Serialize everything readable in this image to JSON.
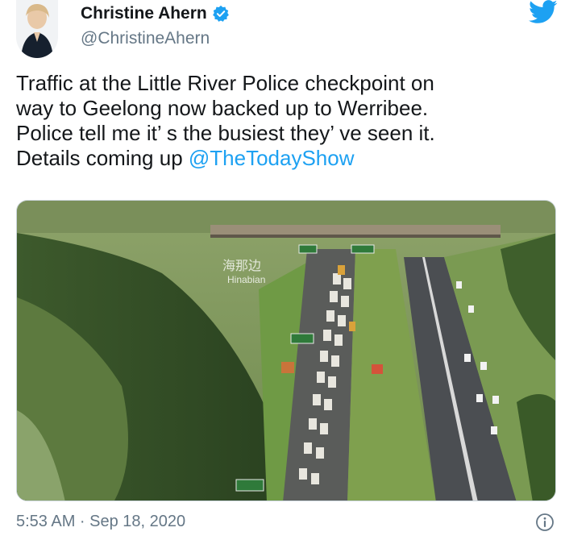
{
  "author": {
    "display_name": "Christine Ahern",
    "handle": "@ChristineAhern"
  },
  "icons": {
    "verified": "verified-badge-icon",
    "platform": "twitter-bird-icon",
    "info": "info-icon"
  },
  "tweet": {
    "line1": "Traffic at the Little River Police checkpoint on",
    "line2": "way to Geelong now backed up to Werribee.",
    "line3": "Police tell me it’ s the busiest they’ ve seen it.",
    "line4_prefix": "Details coming up ",
    "mention": "@TheTodayShow"
  },
  "media": {
    "watermark_cn": "海那边",
    "watermark_en": "Hinabian"
  },
  "timestamp": "5:53 AM · Sep 18, 2020",
  "colors": {
    "accent": "#1da1f2",
    "secondary_text": "#657786"
  }
}
